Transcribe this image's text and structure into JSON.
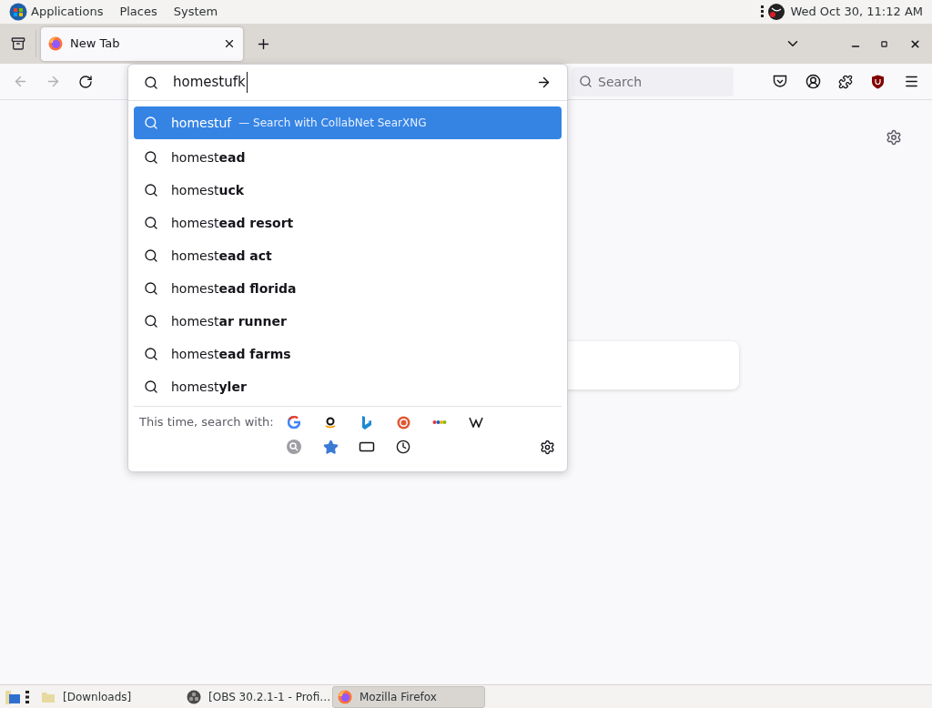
{
  "top_panel": {
    "menus": [
      "Applications",
      "Places",
      "System"
    ],
    "clock": "Wed Oct 30, 11:12 AM"
  },
  "tabs": [
    {
      "title": "New Tab",
      "selected": true
    }
  ],
  "url_bar": {
    "value": "homestufk"
  },
  "search_field": {
    "placeholder": "Search"
  },
  "dropdown": {
    "suggestions": [
      {
        "text": "homestuf",
        "action": "— Search with CollabNet SearXNG",
        "selected": true
      },
      {
        "text": "homest**ead**",
        "selected": false
      },
      {
        "text": "homest**uck**",
        "selected": false
      },
      {
        "text": "homest**ead resort**",
        "selected": false
      },
      {
        "text": "homest**ead act**",
        "selected": false
      },
      {
        "text": "homest**ead florida**",
        "selected": false
      },
      {
        "text": "homest**ar runner**",
        "selected": false
      },
      {
        "text": "homest**ead farms**",
        "selected": false
      },
      {
        "text": "homest**yler**",
        "selected": false
      }
    ],
    "engines_label": "This time, search with:"
  },
  "taskbar": {
    "tasks": [
      {
        "kind": "folder",
        "label": "[Downloads]",
        "selected": false
      },
      {
        "kind": "obs",
        "label": "[OBS 30.2.1-1 - Profi…",
        "selected": false
      },
      {
        "kind": "firefox",
        "label": "Mozilla Firefox",
        "selected": true
      }
    ]
  }
}
